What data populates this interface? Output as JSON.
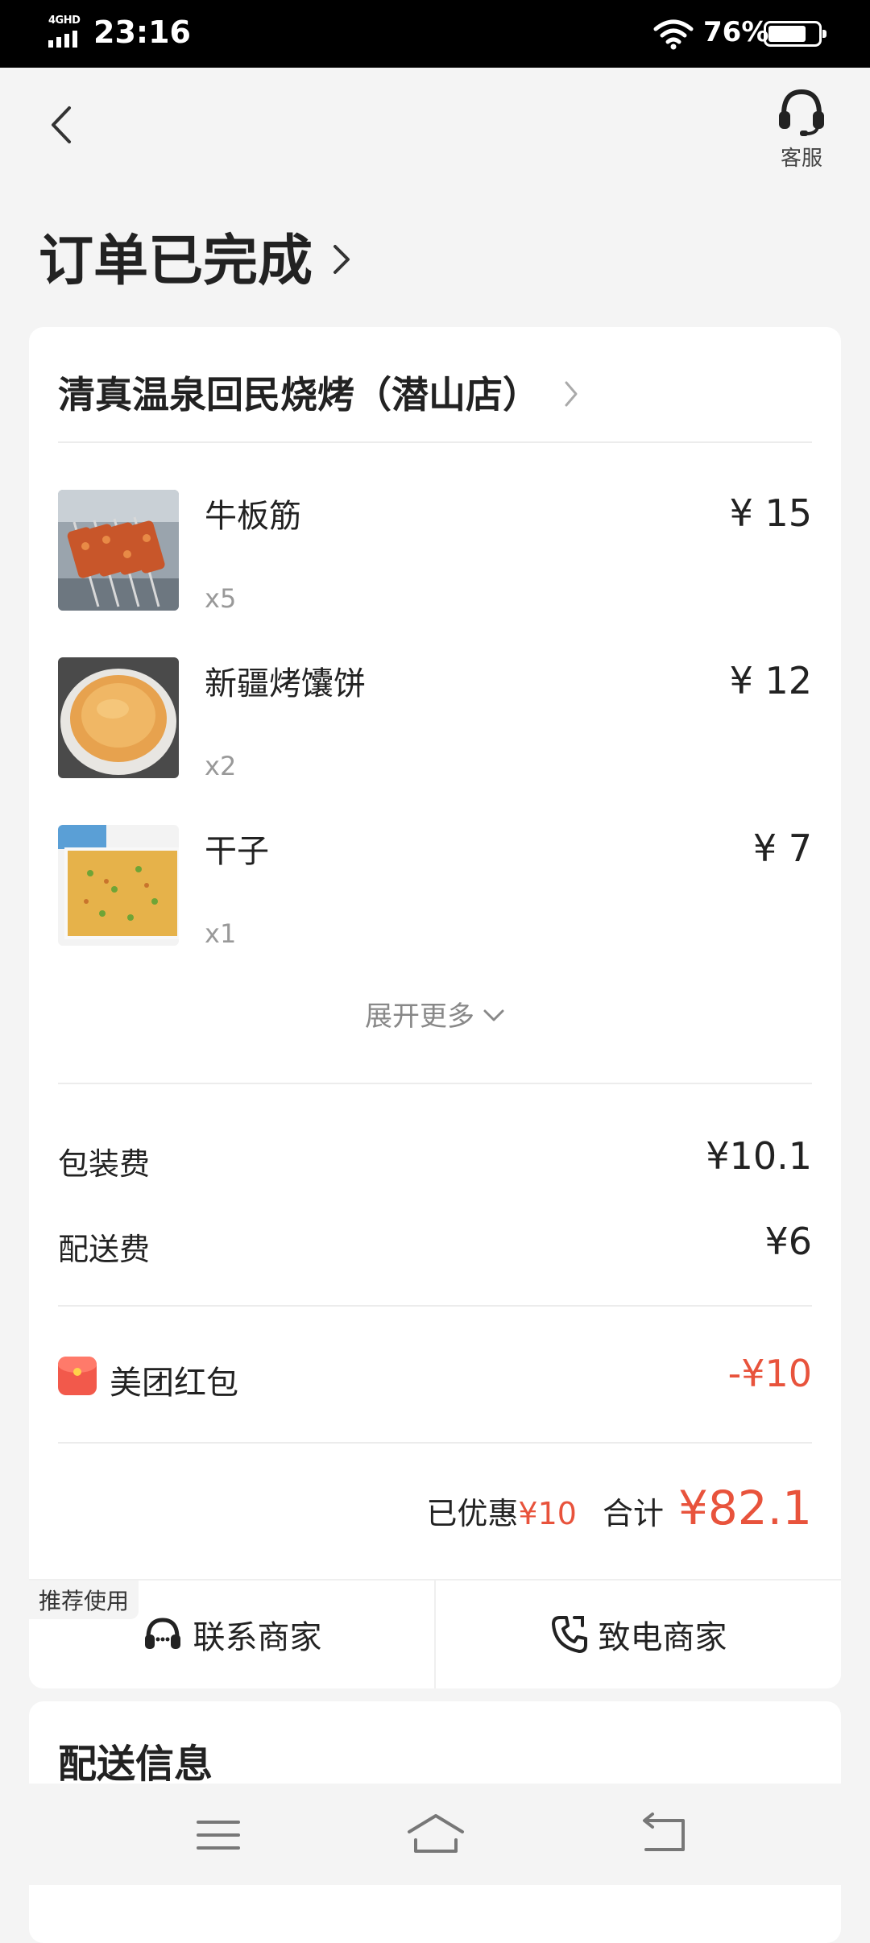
{
  "status_bar": {
    "network": "4GHD",
    "time": "23:16",
    "battery_percent": "76%",
    "battery_level": 0.76
  },
  "header": {
    "service_label": "客服"
  },
  "order": {
    "status_title": "订单已完成"
  },
  "shop": {
    "name": "清真温泉回民烧烤（潜山店）"
  },
  "items": [
    {
      "name": "牛板筋",
      "qty": "x5",
      "price": "¥ 15"
    },
    {
      "name": "新疆烤馕饼",
      "qty": "x2",
      "price": "¥ 12"
    },
    {
      "name": "干子",
      "qty": "x1",
      "price": "¥ 7"
    }
  ],
  "expand_label": "展开更多",
  "fees": {
    "packaging_label": "包装费",
    "packaging_value": "¥10.1",
    "delivery_label": "配送费",
    "delivery_value": "¥6"
  },
  "discount": {
    "label": "美团红包",
    "value": "-¥10"
  },
  "summary": {
    "discount_label": "已优惠",
    "discount_value": "¥10",
    "total_label": "合计",
    "total_value": "¥82.1"
  },
  "actions": {
    "recommend_badge": "推荐使用",
    "contact_label": "联系商家",
    "call_label": "致电商家"
  },
  "delivery_section": {
    "title": "配送信息"
  },
  "colors": {
    "accent_red": "#e8533c",
    "background": "#f4f4f4"
  }
}
